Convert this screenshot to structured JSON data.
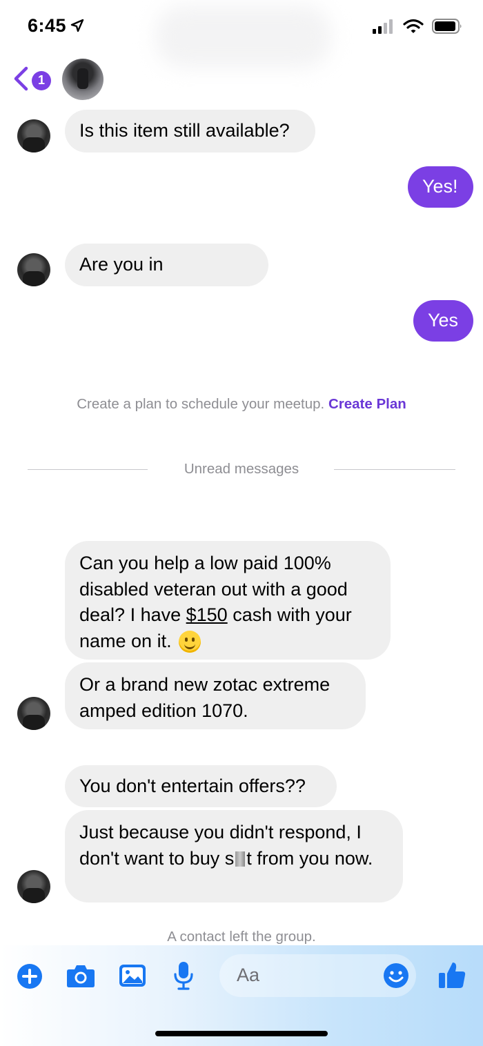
{
  "status_bar": {
    "time": "6:45"
  },
  "header": {
    "unread_count": "1"
  },
  "messages": [
    {
      "text": "Is this item still available?"
    },
    {
      "text": "Yes!"
    },
    {
      "text": "Are you in"
    },
    {
      "text": "Yes"
    }
  ],
  "plan_prompt": {
    "text": "Create a plan to schedule your meetup.",
    "link": "Create Plan"
  },
  "unread_divider": "Unread messages",
  "offer_message": {
    "part1": "Can you help a low paid 100% disabled veteran out with a good deal?  I have ",
    "amount": "$150",
    "part2": " cash with your name on it."
  },
  "zotac_message": "Or a brand new zotac extreme amped edition 1070.",
  "entertain_message": "You don't entertain offers??",
  "respond_message": {
    "part1": "Just because you didn't respond, I don't want to buy s",
    "part2": "t from you now."
  },
  "system_notice": "A contact left the group.",
  "composer": {
    "placeholder": "Aa"
  },
  "colors": {
    "accent": "#7b3fe4",
    "messenger_blue": "#1877f2",
    "received_bubble": "#efefef"
  }
}
